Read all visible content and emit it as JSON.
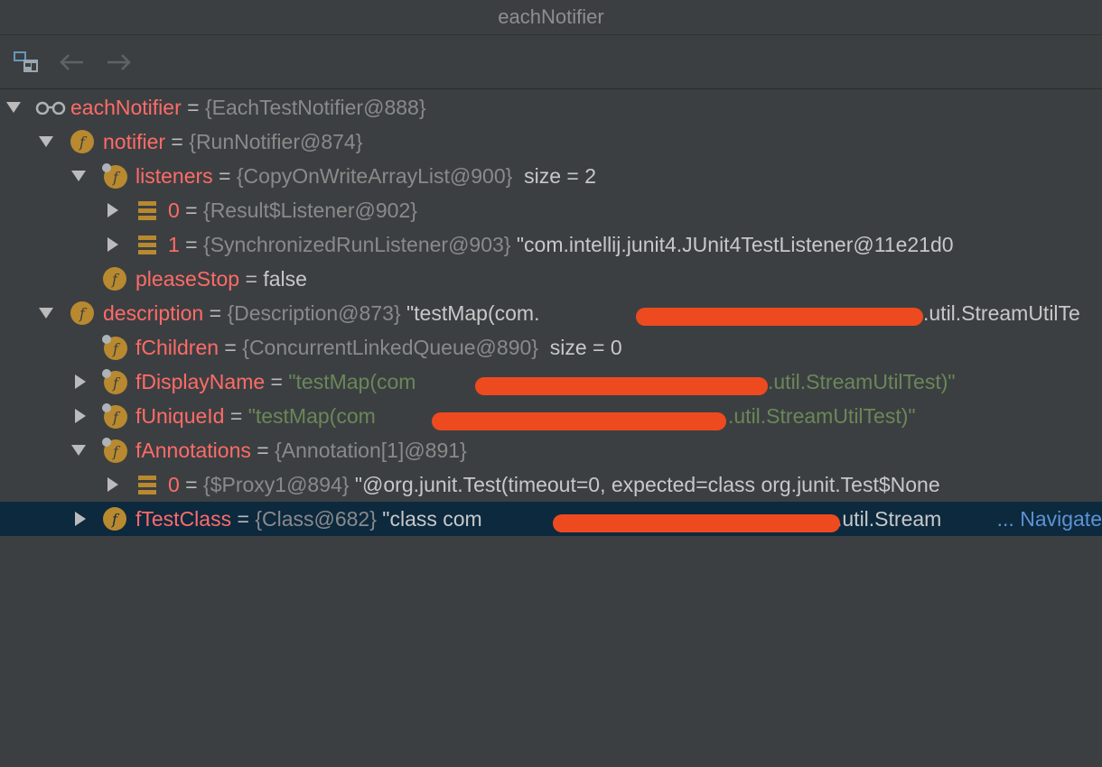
{
  "window": {
    "title": "eachNotifier"
  },
  "toolbar": {
    "icons": [
      "restore-layout-icon",
      "back-arrow-icon",
      "forward-arrow-icon"
    ]
  },
  "tree": {
    "rows": [
      {
        "name": "eachNotifier",
        "sep": " = ",
        "type": "{EachTestNotifier@888}",
        "rest": ""
      },
      {
        "name": "notifier",
        "sep": " = ",
        "type": "{RunNotifier@874}",
        "rest": ""
      },
      {
        "name": "listeners",
        "sep": " = ",
        "type": "{CopyOnWriteArrayList@900}",
        "rest": "  size = 2"
      },
      {
        "name": "0",
        "sep": " = ",
        "type": "{Result$Listener@902}",
        "rest": ""
      },
      {
        "name": "1",
        "sep": " = ",
        "type": "{SynchronizedRunListener@903}",
        "rest": " \"com.intellij.junit4.JUnit4TestListener@11e21d0"
      },
      {
        "name": "pleaseStop",
        "sep": " = ",
        "type": "",
        "rest": "false"
      },
      {
        "name": "description",
        "sep": " = ",
        "type": "{Description@873}",
        "rest": " \"testMap(com.",
        "rest2": ".util.StreamUtilTe"
      },
      {
        "name": "fChildren",
        "sep": " = ",
        "type": "{ConcurrentLinkedQueue@890}",
        "rest": "  size = 0"
      },
      {
        "name": "fDisplayName",
        "sep": " = ",
        "str1": "\"testMap(com",
        "str2": ".util.StreamUtilTest)\""
      },
      {
        "name": "fUniqueId",
        "sep": " = ",
        "str1": "\"testMap(com",
        "str2": ".util.StreamUtilTest)\""
      },
      {
        "name": "fAnnotations",
        "sep": " = ",
        "type": "{Annotation[1]@891}",
        "rest": ""
      },
      {
        "name": "0",
        "sep": " = ",
        "type": "{$Proxy1@894}",
        "rest": " \"@org.junit.Test(timeout=0, expected=class org.junit.Test$None"
      },
      {
        "name": "fTestClass",
        "sep": " = ",
        "type": "{Class@682}",
        "rest": " \"class com",
        "rest2": ".util.Stream",
        "nav": "... Navigate"
      }
    ]
  },
  "colors": {
    "background": "#3c3f41",
    "name": "#ff6b68",
    "type": "#8a8a8a",
    "string": "#6a8759",
    "selection": "#0d293e",
    "field_icon": "#b8892f",
    "redaction": "#ee4a20"
  }
}
